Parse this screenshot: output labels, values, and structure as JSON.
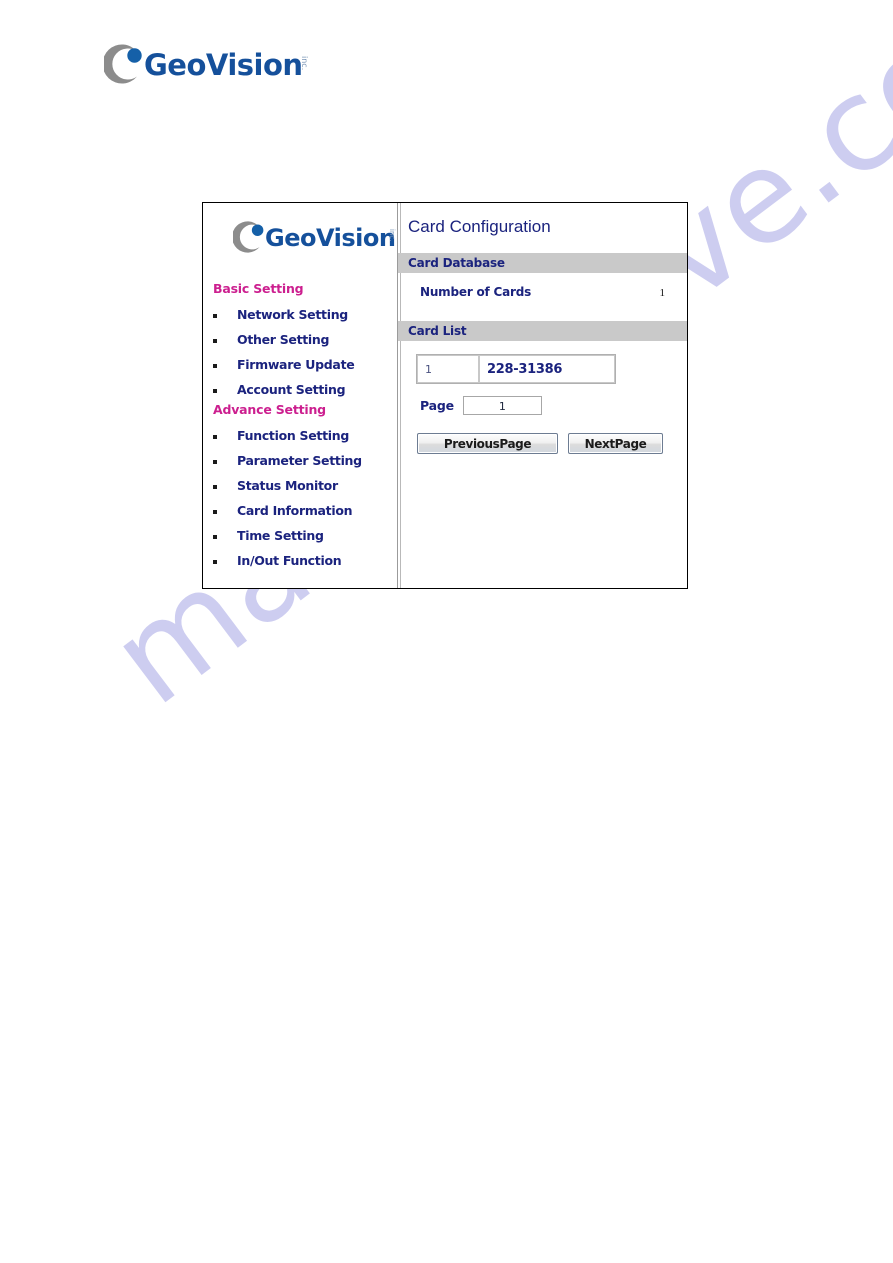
{
  "watermark": {
    "text": "manualshive.com",
    "color": "#cbcbf0"
  },
  "brand": {
    "name": "GeoVision",
    "suffix": "inc.",
    "wordmark_color": "#15509b",
    "mark_color": "#8c8c8c",
    "dot_color": "#1560a8"
  },
  "panel": {
    "nav": {
      "groups": [
        {
          "title": "Basic Setting",
          "title_color": "#cc1f8f",
          "items": [
            {
              "label": "Network Setting"
            },
            {
              "label": "Other Setting"
            },
            {
              "label": "Firmware Update"
            },
            {
              "label": "Account Setting"
            }
          ]
        },
        {
          "title": "Advance Setting",
          "title_color": "#cc1f8f",
          "items": [
            {
              "label": "Function Setting"
            },
            {
              "label": "Parameter Setting"
            },
            {
              "label": "Status Monitor"
            },
            {
              "label": "Card Information"
            },
            {
              "label": "Time Setting"
            },
            {
              "label": "In/Out Function"
            }
          ]
        }
      ]
    },
    "content": {
      "title": "Card Configuration",
      "card_database": {
        "section_label": "Card Database",
        "number_of_cards_label": "Number of Cards",
        "number_of_cards_value": "1"
      },
      "card_list": {
        "section_label": "Card List",
        "rows": [
          {
            "index": "1",
            "card_number": "228-31386"
          }
        ]
      },
      "pagination": {
        "page_label": "Page",
        "page_value": "1",
        "previous_label": "PreviousPage",
        "next_label": "NextPage"
      }
    }
  }
}
